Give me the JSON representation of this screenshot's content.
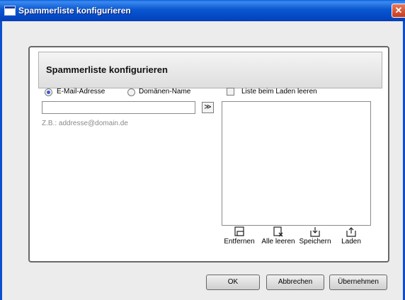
{
  "window": {
    "title": "Spammerliste konfigurieren",
    "close_glyph": "✕"
  },
  "panel": {
    "title": "Spammerliste konfigurieren"
  },
  "options": {
    "email_label": "E-Mail-Adresse",
    "domain_label": "Domänen-Name",
    "selected": "email",
    "clear_on_load_label": "Liste beim Laden leeren",
    "clear_on_load_checked": false
  },
  "input": {
    "value": "",
    "hint": "Z.B.: addresse@domain.de",
    "add_glyph": "≫"
  },
  "list": {
    "items": []
  },
  "tools": {
    "remove": "Entfernen",
    "clear_all": "Alle leeren",
    "save": "Speichern",
    "load": "Laden"
  },
  "buttons": {
    "ok": "OK",
    "cancel": "Abbrechen",
    "apply": "Übernehmen"
  },
  "colors": {
    "titlebar": "#0a57d0",
    "panel_border": "#686868",
    "radio_dot": "#3b5bd0"
  }
}
